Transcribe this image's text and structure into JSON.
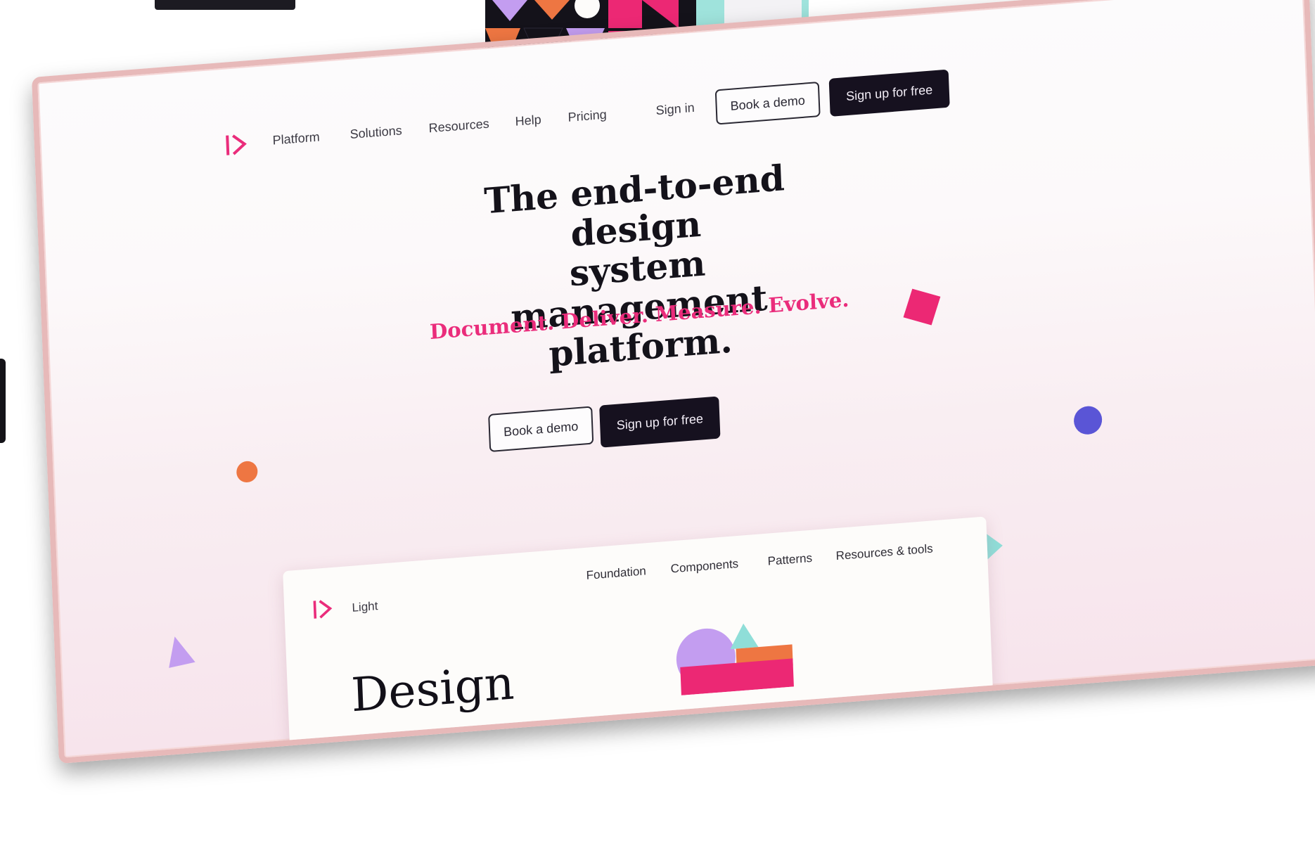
{
  "nav": {
    "links": [
      "Platform",
      "Solutions",
      "Resources",
      "Help",
      "Pricing"
    ],
    "sign_in": "Sign in",
    "book_demo": "Book a demo",
    "sign_up": "Sign up for free"
  },
  "hero": {
    "title_line1": "The end-to-end design",
    "title_line2": "system management",
    "title_line3": "platform.",
    "tagline": "Document. Deliver. Measure. Evolve.",
    "cta_demo": "Book a demo",
    "cta_signup": "Sign up for free"
  },
  "preview": {
    "theme_label": "Light",
    "links": [
      "Foundation",
      "Components",
      "Patterns",
      "Resources & tools"
    ],
    "heading": "Design"
  },
  "colors": {
    "brand_pink": "#ea2c7b",
    "dark": "#16111f",
    "frame": "#e7b9b9",
    "orange": "#ee7642",
    "blue": "#5a55d6",
    "lilac": "#c39df0",
    "teal": "#8fded8"
  }
}
